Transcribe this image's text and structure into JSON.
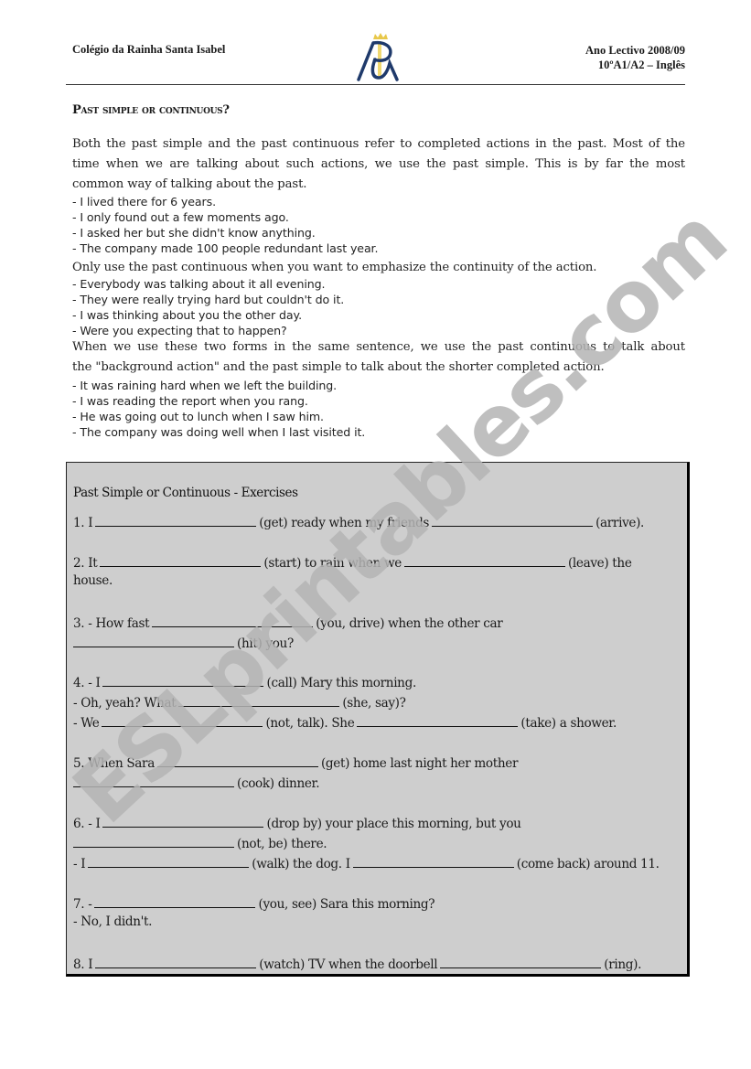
{
  "header": {
    "school": "Colégio da Rainha Santa Isabel",
    "year": "Ano Lectivo 2008/09",
    "class": "10ºA1/A2 – Inglês",
    "logo_icon": "school-crest-icon"
  },
  "title": "Past simple or continuous?",
  "intro": {
    "p1_lines": [
      "Both the past simple and the past continuous refer to completed actions in the past. Most of the",
      "time when we are talking about such actions, we use the past simple. This is by far the most",
      "common way of talking about the past."
    ],
    "bullets1": [
      "- I lived there for 6 years.",
      "- I only found out a few moments ago.",
      "- I asked her but she didn't know anything.",
      "- The company made 100 people redundant last year."
    ],
    "p2": "Only use the past continuous when you want to emphasize the continuity of the action.",
    "bullets2": [
      "- Everybody was talking about it all evening.",
      "- They were really trying hard but couldn't do it.",
      "- I was thinking about you the other day.",
      "- Were you expecting that to happen?"
    ],
    "p3_lines": [
      "When we use these two forms in the same sentence, we use the past continuous to talk about",
      "the \"background action\" and the past simple to talk about the shorter completed action."
    ],
    "bullets3": [
      "- It was raining hard when we left the building.",
      "- I was reading the report when you rang.",
      "- He was going out to lunch when I saw him.",
      "- The company was doing well when I last visited it."
    ]
  },
  "exercises": {
    "title": "Past Simple or Continuous - Exercises",
    "lines": [
      {
        "pre": "1. I",
        "mid": "(get) ready when my friends",
        "post": "(arrive)."
      },
      {
        "pre": "2. It",
        "mid": "(start) to rain when we",
        "post": "(leave) the"
      },
      {
        "text": "house."
      },
      {
        "pre": "3. - How fast",
        "post": "(you, drive) when the other car"
      },
      {
        "post": "(hit) you?"
      },
      {
        "pre": "4. - I",
        "post": "(call) Mary this morning."
      },
      {
        "pre": "- Oh, yeah? What",
        "post": "(she, say)?"
      },
      {
        "pre": "- We",
        "mid": "(not, talk). She",
        "post": "(take) a shower."
      },
      {
        "pre": "5. When Sara",
        "post": "(get) home last night her mother"
      },
      {
        "post": "(cook) dinner."
      },
      {
        "pre": "6. - I",
        "post": "(drop by) your place this morning, but you"
      },
      {
        "post": "(not, be) there."
      },
      {
        "pre": "- I",
        "mid": "(walk) the dog. I",
        "post": "(come back) around 11."
      },
      {
        "pre": "7. -",
        "post": "(you, see) Sara this morning?"
      },
      {
        "text": "- No, I didn't."
      },
      {
        "pre": "8. I",
        "mid": "(watch) TV when the doorbell",
        "post": "(ring)."
      }
    ]
  },
  "watermark": {
    "text": "ESLprintables.com",
    "color": "#b4b4b4"
  },
  "colors": {
    "box_background": "#cecece",
    "logo_blue": "#1f3a6b",
    "logo_gold": "#e8c84a"
  }
}
